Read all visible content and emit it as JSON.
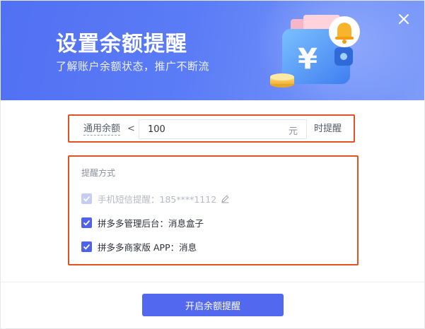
{
  "banner": {
    "title": "设置余额提醒",
    "subtitle": "了解账户余额状态，推广不断流",
    "close_icon": "close-icon",
    "illustration": "wallet-bell-illustration"
  },
  "threshold": {
    "label": "通用余额",
    "operator": "<",
    "value": "100",
    "unit": "元",
    "suffix": "时提醒"
  },
  "methods": {
    "title": "提醒方式",
    "options": [
      {
        "label": "手机短信提醒：185****1112",
        "checked": true,
        "disabled": true,
        "icon": "edit-icon"
      },
      {
        "label": "拼多多管理后台：消息盒子",
        "checked": true,
        "disabled": false
      },
      {
        "label": "拼多多商家版 APP：消息",
        "checked": true,
        "disabled": false
      }
    ]
  },
  "footer": {
    "submit_label": "开启余额提醒"
  },
  "colors": {
    "accent": "#5268ef",
    "highlight_border": "#e0521f",
    "banner": "#5b7cf6"
  }
}
